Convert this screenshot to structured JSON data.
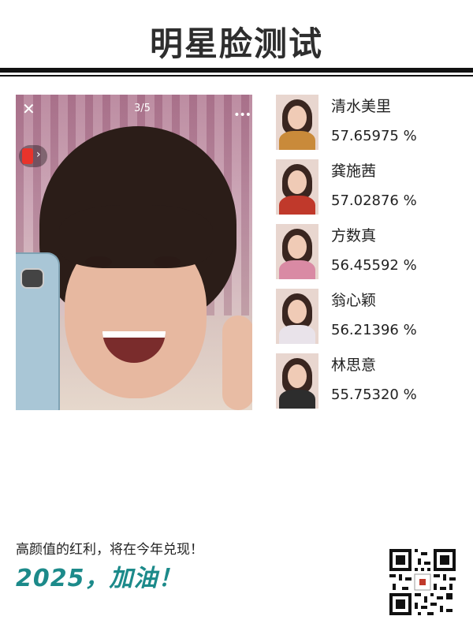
{
  "header": {
    "title": "明星脸测试"
  },
  "photo": {
    "pager": "3/5",
    "close_glyph": "✕",
    "more_glyph": "•••",
    "redpacket_arrow": "›"
  },
  "results": [
    {
      "name": "清水美里",
      "score": "57.65975 %",
      "body_color": "#c98a3a"
    },
    {
      "name": "龚施茜",
      "score": "57.02876 %",
      "body_color": "#c0392b"
    },
    {
      "name": "方数真",
      "score": "56.45592 %",
      "body_color": "#d98aa4"
    },
    {
      "name": "翁心颖",
      "score": "56.21396 %",
      "body_color": "#e9e3ea"
    },
    {
      "name": "林思意",
      "score": "55.75320 %",
      "body_color": "#2d2d2d"
    }
  ],
  "footer": {
    "slogan": "高颜值的红利，将在今年兑现！",
    "cheer": "2025，加油！"
  },
  "colors": {
    "accent": "#1c8a8a",
    "title": "#2e2e2e"
  }
}
